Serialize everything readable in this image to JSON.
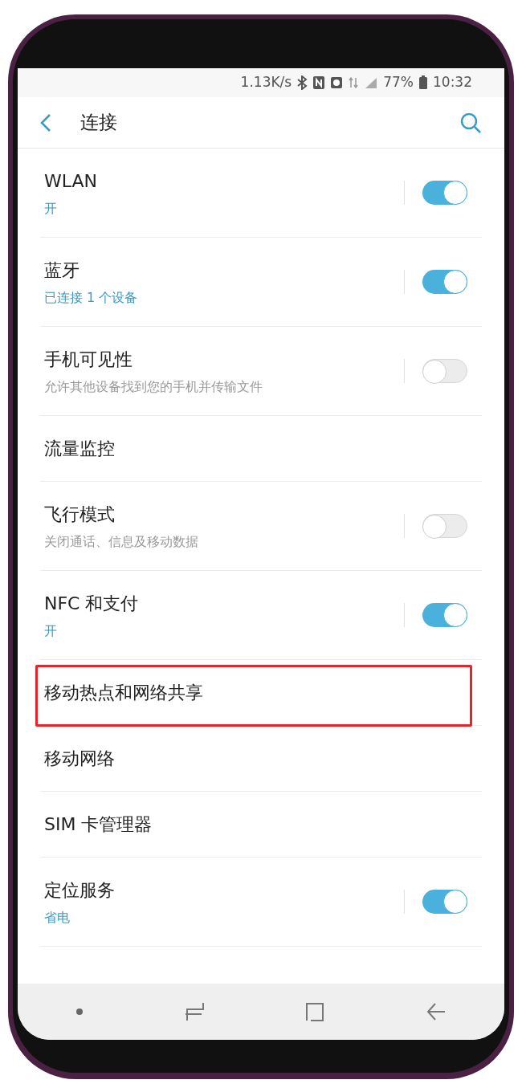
{
  "status_bar": {
    "speed": "1.13K/s",
    "battery": "77%",
    "time": "10:32"
  },
  "header": {
    "title": "连接"
  },
  "settings": [
    {
      "title": "WLAN",
      "subtitle": "开",
      "kind": "toggle",
      "on": true,
      "highlighted": false
    },
    {
      "title": "蓝牙",
      "subtitle": "已连接 1 个设备",
      "kind": "toggle",
      "on": true,
      "highlighted": false
    },
    {
      "title": "手机可见性",
      "subtitle": "允许其他设备找到您的手机并传输文件",
      "kind": "toggle",
      "on": false,
      "highlighted": false
    },
    {
      "title": "流量监控",
      "kind": "plain",
      "highlighted": false
    },
    {
      "title": "飞行模式",
      "subtitle": "关闭通话、信息及移动数据",
      "kind": "toggle",
      "on": false,
      "highlighted": false
    },
    {
      "title": "NFC 和支付",
      "subtitle": "开",
      "kind": "toggle",
      "on": true,
      "highlighted": false
    },
    {
      "title": "移动热点和网络共享",
      "kind": "plain",
      "highlighted": true
    },
    {
      "title": "移动网络",
      "kind": "plain",
      "highlighted": false
    },
    {
      "title": "SIM 卡管理器",
      "kind": "plain",
      "highlighted": false
    },
    {
      "title": "定位服务",
      "subtitle": "省电",
      "kind": "toggle",
      "on": true,
      "highlighted": false
    }
  ]
}
